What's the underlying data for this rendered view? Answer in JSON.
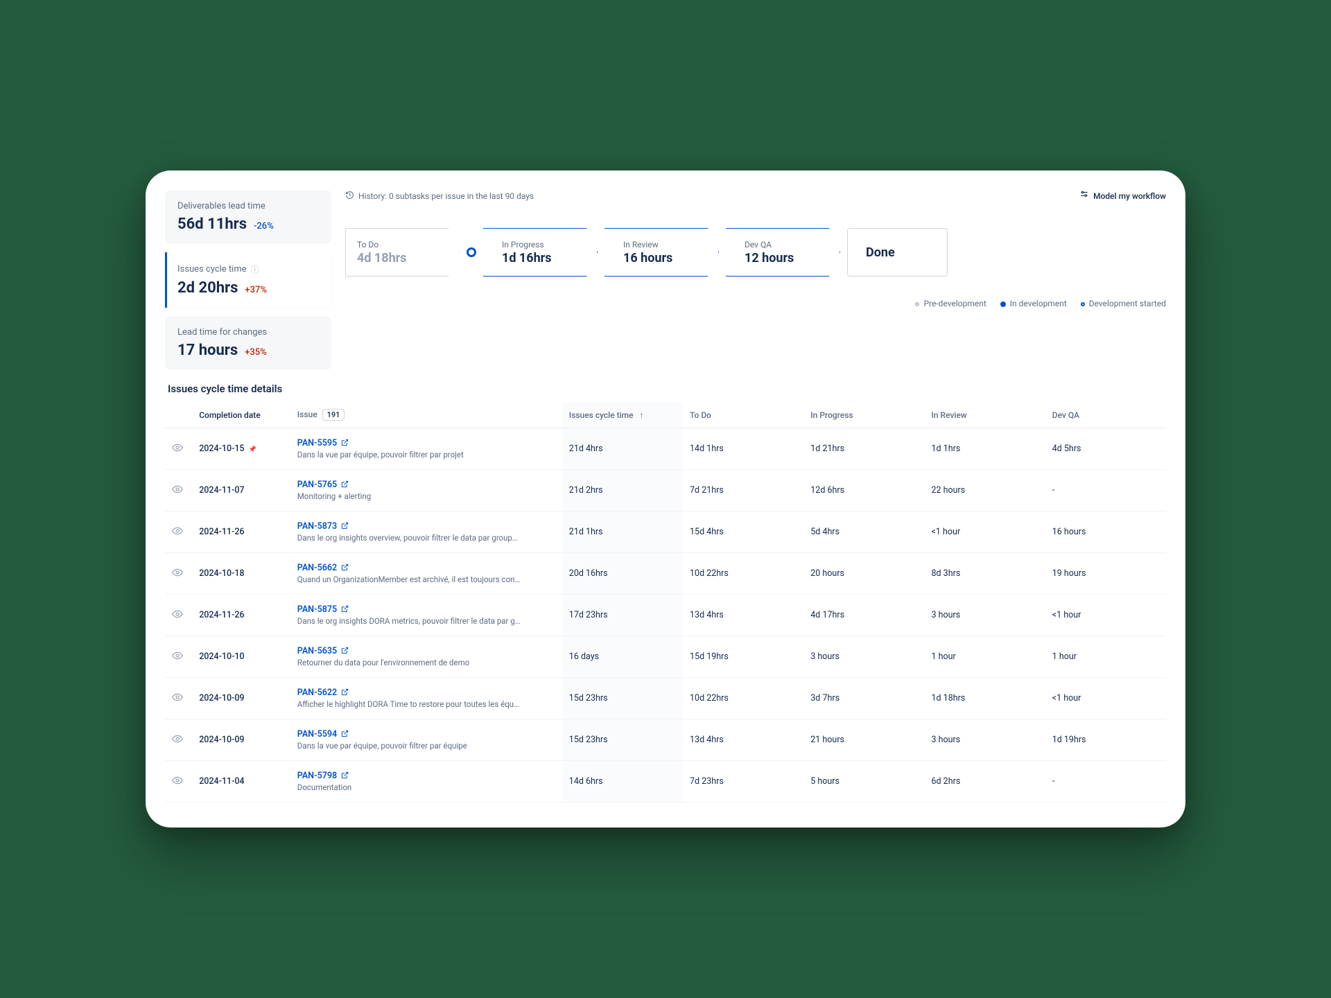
{
  "header": {
    "history_text": "History: 0 subtasks per issue in the last 90 days",
    "model_workflow": "Model my workflow"
  },
  "metrics": {
    "deliverables": {
      "label": "Deliverables lead time",
      "value": "56d 11hrs",
      "delta": "-26%"
    },
    "cycle": {
      "label": "Issues cycle time",
      "value": "2d 20hrs",
      "delta": "+37%"
    },
    "lead_changes": {
      "label": "Lead time for changes",
      "value": "17 hours",
      "delta": "+35%"
    }
  },
  "stages": {
    "todo": {
      "label": "To Do",
      "value": "4d 18hrs"
    },
    "in_progress": {
      "label": "In Progress",
      "value": "1d 16hrs"
    },
    "in_review": {
      "label": "In Review",
      "value": "16 hours"
    },
    "dev_qa": {
      "label": "Dev QA",
      "value": "12 hours"
    },
    "done": {
      "label": "Done"
    }
  },
  "legend": {
    "pre": "Pre-development",
    "in": "In development",
    "start": "Development started"
  },
  "details_title": "Issues cycle time details",
  "table": {
    "issue_count": "191",
    "headers": {
      "completion": "Completion date",
      "issue": "Issue",
      "cycle": "Issues cycle time",
      "todo": "To Do",
      "in_progress": "In Progress",
      "in_review": "In Review",
      "dev_qa": "Dev QA"
    },
    "rows": [
      {
        "completion": "2024-10-15",
        "pinned": true,
        "key": "PAN-5595",
        "desc": "Dans la vue par équipe, pouvoir filtrer par projet",
        "cycle": "21d 4hrs",
        "todo": "14d 1hrs",
        "in_progress": "1d 21hrs",
        "in_review": "1d 1hrs",
        "dev_qa": "4d 5hrs"
      },
      {
        "completion": "2024-11-07",
        "key": "PAN-5765",
        "desc": "Monitoring + alerting",
        "cycle": "21d 2hrs",
        "todo": "7d 21hrs",
        "in_progress": "12d 6hrs",
        "in_review": "22 hours",
        "dev_qa": "-"
      },
      {
        "completion": "2024-11-26",
        "key": "PAN-5873",
        "desc": "Dans le org insights overview, pouvoir filtrer le data par group…",
        "cycle": "21d 1hrs",
        "todo": "15d 4hrs",
        "in_progress": "5d 4hrs",
        "in_review": "<1 hour",
        "dev_qa": "16 hours"
      },
      {
        "completion": "2024-10-18",
        "key": "PAN-5662",
        "desc": "Quand un OrganizationMember est archivé, il est toujours con…",
        "cycle": "20d 16hrs",
        "todo": "10d 22hrs",
        "in_progress": "20 hours",
        "in_review": "8d 3hrs",
        "dev_qa": "19 hours"
      },
      {
        "completion": "2024-11-26",
        "key": "PAN-5875",
        "desc": "Dans le org insights DORA metrics, pouvoir filtrer le data par g…",
        "cycle": "17d 23hrs",
        "todo": "13d 4hrs",
        "in_progress": "4d 17hrs",
        "in_review": "3 hours",
        "dev_qa": "<1 hour"
      },
      {
        "completion": "2024-10-10",
        "key": "PAN-5635",
        "desc": "Retourner du data pour l'environnement de demo",
        "cycle": "16 days",
        "todo": "15d 19hrs",
        "in_progress": "3 hours",
        "in_review": "1 hour",
        "dev_qa": "1 hour"
      },
      {
        "completion": "2024-10-09",
        "key": "PAN-5622",
        "desc": "Afficher le highlight DORA Time to restore pour toutes les équ…",
        "cycle": "15d 23hrs",
        "todo": "10d 22hrs",
        "in_progress": "3d 7hrs",
        "in_review": "1d 18hrs",
        "dev_qa": "<1 hour"
      },
      {
        "completion": "2024-10-09",
        "key": "PAN-5594",
        "desc": "Dans la vue par équipe, pouvoir filtrer par équipe",
        "cycle": "15d 23hrs",
        "todo": "13d 4hrs",
        "in_progress": "21 hours",
        "in_review": "3 hours",
        "dev_qa": "1d 19hrs"
      },
      {
        "completion": "2024-11-04",
        "key": "PAN-5798",
        "desc": "Documentation",
        "cycle": "14d 6hrs",
        "todo": "7d 23hrs",
        "in_progress": "5 hours",
        "in_review": "6d 2hrs",
        "dev_qa": "-"
      }
    ]
  }
}
